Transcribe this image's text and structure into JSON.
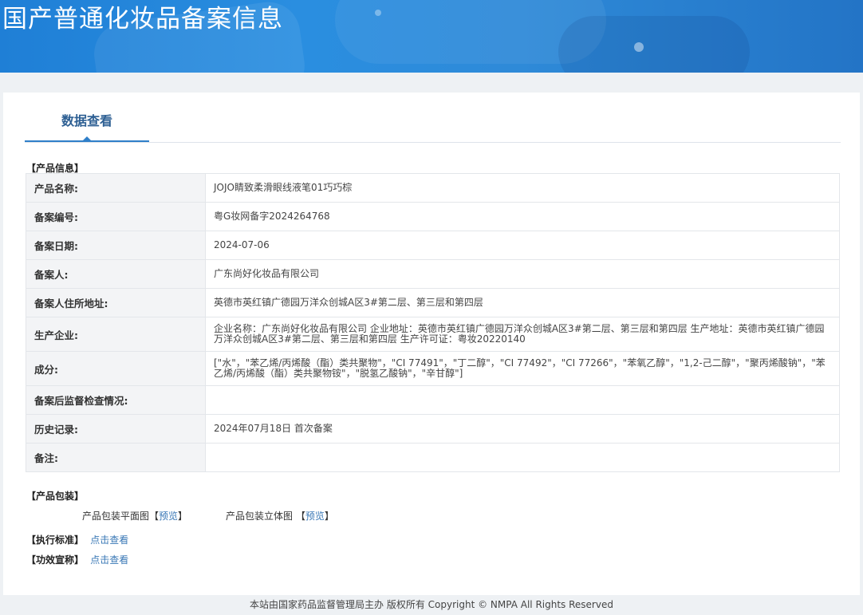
{
  "header": {
    "title": "国产普通化妆品备案信息"
  },
  "tabs": [
    {
      "label": "数据查看",
      "active": true
    }
  ],
  "sections": {
    "product_info": "【产品信息】",
    "packaging": "【产品包装】",
    "standard": "【执行标准】",
    "efficacy": "【功效宣称】"
  },
  "info_rows": [
    {
      "label": "产品名称:",
      "value": "JOJO睛致柔滑眼线液笔01巧巧棕"
    },
    {
      "label": "备案编号:",
      "value": "粤G妆网备字2024264768"
    },
    {
      "label": "备案日期:",
      "value": "2024-07-06"
    },
    {
      "label": "备案人:",
      "value": "广东尚好化妆品有限公司"
    },
    {
      "label": "备案人住所地址:",
      "value": "英德市英红镇广德园万洋众创城A区3#第二层、第三层和第四层"
    },
    {
      "label": "生产企业:",
      "value": "企业名称：广东尚好化妆品有限公司 企业地址：英德市英红镇广德园万洋众创城A区3#第二层、第三层和第四层 生产地址：英德市英红镇广德园万洋众创城A区3#第二层、第三层和第四层 生产许可证：粤妆20220140"
    },
    {
      "label": "成分:",
      "value": "[\"水\"，\"苯乙烯/丙烯酸（酯）类共聚物\"，\"CI 77491\"，\"丁二醇\"，\"CI 77492\"，\"CI 77266\"，\"苯氧乙醇\"，\"1,2-己二醇\"，\"聚丙烯酸钠\"，\"苯乙烯/丙烯酸（酯）类共聚物铵\"，\"脱氢乙酸钠\"，\"辛甘醇\"]"
    },
    {
      "label": "备案后监督检查情况:",
      "value": ""
    },
    {
      "label": "历史记录:",
      "value": "2024年07月18日 首次备案"
    },
    {
      "label": "备注:",
      "value": ""
    }
  ],
  "packaging": {
    "flat_label": "产品包装平面图",
    "solid_label": "产品包装立体图",
    "bracket_open": "【",
    "bracket_close": "】",
    "preview": "预览"
  },
  "view_link": "点击查看",
  "footer": {
    "text": "本站由国家药品监督管理局主办 版权所有 Copyright © NMPA All Rights Reserved"
  }
}
